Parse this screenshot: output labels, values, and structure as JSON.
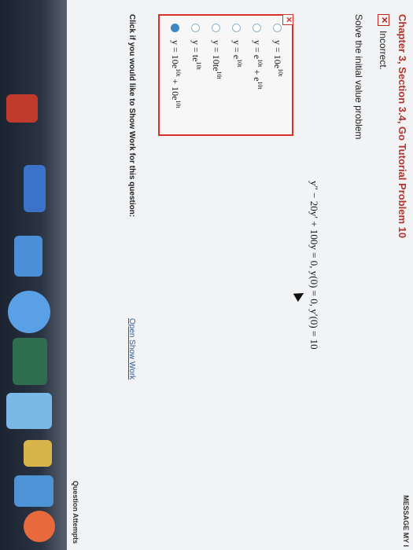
{
  "header": {
    "title": "Chapter 3, Section 3.4, Go Tutorial Problem 10",
    "message_link": "MESSAGE MY I"
  },
  "status": {
    "label": "Incorrect.",
    "icon": "x-box-icon"
  },
  "question": {
    "prompt": "Solve the initial value problem",
    "equation": "y″ − 20y′ + 100y = 0, y(0) = 0, y′(0) = 10"
  },
  "answers": {
    "selected_index": 5,
    "options": [
      {
        "base": "y = 10e",
        "exp": "10t",
        "tail": ""
      },
      {
        "base": "y = e",
        "exp": "10t",
        "tail": " + e",
        "exp2": "10t"
      },
      {
        "base": "y = e",
        "exp": "10t",
        "tail": ""
      },
      {
        "base": "y = 10te",
        "exp": "10t",
        "tail": ""
      },
      {
        "base": "y = te",
        "exp": "10t",
        "tail": ""
      },
      {
        "base": "y = 10e",
        "exp": "10t",
        "tail": " + 10e",
        "exp2": "10t"
      }
    ]
  },
  "show_work": {
    "text": "Click if you would like to Show Work for this question:",
    "link": "Open Show Work"
  },
  "footer": {
    "attempts_label": "Question Attempts"
  },
  "colors": {
    "error": "#d8312a",
    "selected": "#3f86c4",
    "link": "#2c5aa0"
  }
}
